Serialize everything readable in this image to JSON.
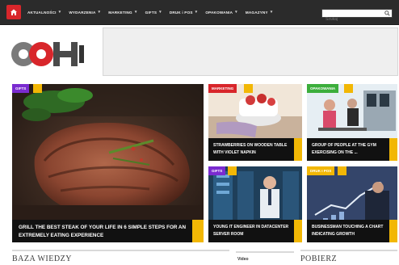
{
  "nav": {
    "menu": [
      {
        "label": "AKTUALNOŚCI"
      },
      {
        "label": "WYDARZENIA"
      },
      {
        "label": "MARKETING"
      },
      {
        "label": "GIFTS"
      },
      {
        "label": "DRUK i POS"
      },
      {
        "label": "OPAKOWANIA"
      },
      {
        "label": "MAGAZYNY"
      }
    ],
    "search_placeholder": "Szukaj"
  },
  "logo": {
    "text": "OOH"
  },
  "tiles": {
    "big": {
      "badge": "GIFTS",
      "badge_color": "#7a2bd0",
      "caption": "GRILL THE BEST STEAK OF YOUR LIFE IN 6 SIMPLE STEPS FOR AN EXTREMELY EATING EXPERIENCE"
    },
    "t1": {
      "badge": "MARKETING",
      "badge_color": "#d8262b",
      "caption": "STRAWBERRIES ON WOODEN TABLE WITH VIOLET NAPKIN"
    },
    "t2": {
      "badge": "OPAKOWANIA",
      "badge_color": "#3cae3c",
      "caption": "GROUP OF PEOPLE AT THE GYM EXERCISING ON THE ..."
    },
    "t3": {
      "badge": "GIFTS",
      "badge_color": "#7a2bd0",
      "caption": "YOUNG IT ENGINEER IN DATACENTER SERVER ROOM"
    },
    "t4": {
      "badge": "DRUK i POS",
      "badge_color": "#f2b705",
      "caption": "BUSINESSMAN TOUCHING A CHART INDICATING GROWTH"
    }
  },
  "sections": {
    "baza": "BAZA WIEDZY",
    "video": "Video",
    "pobierz": "POBIERZ"
  },
  "colors": {
    "nav_bg": "#2b2b2b",
    "brand_red": "#d8262b",
    "accent_yellow": "#f2b705",
    "caption_bg": "#111111"
  }
}
